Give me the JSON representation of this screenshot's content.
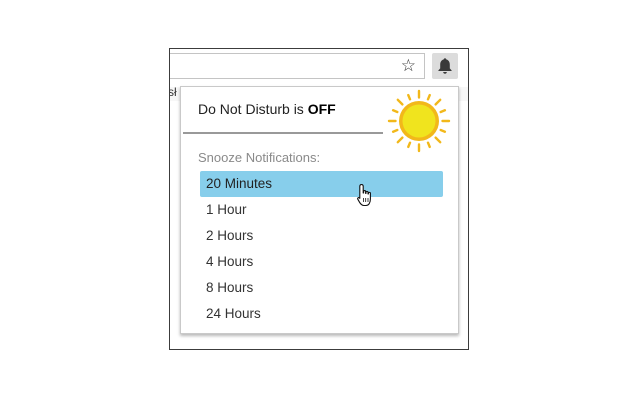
{
  "toolbar": {
    "star_glyph": "☆",
    "bell_icon": "bell-icon",
    "bookmark_fragment": "sł"
  },
  "popup": {
    "dnd_prefix": "Do Not Disturb is ",
    "dnd_state": "OFF",
    "status_icon": "sun-icon",
    "snooze_label": "Snooze Notifications:",
    "options": [
      {
        "label": "20 Minutes",
        "selected": true
      },
      {
        "label": "1 Hour",
        "selected": false
      },
      {
        "label": "2 Hours",
        "selected": false
      },
      {
        "label": "4 Hours",
        "selected": false
      },
      {
        "label": "8 Hours",
        "selected": false
      },
      {
        "label": "24 Hours",
        "selected": false
      }
    ]
  },
  "colors": {
    "highlight": "#87ceeb",
    "sun_fill": "#f0e41e",
    "sun_ring": "#f2b81a"
  }
}
